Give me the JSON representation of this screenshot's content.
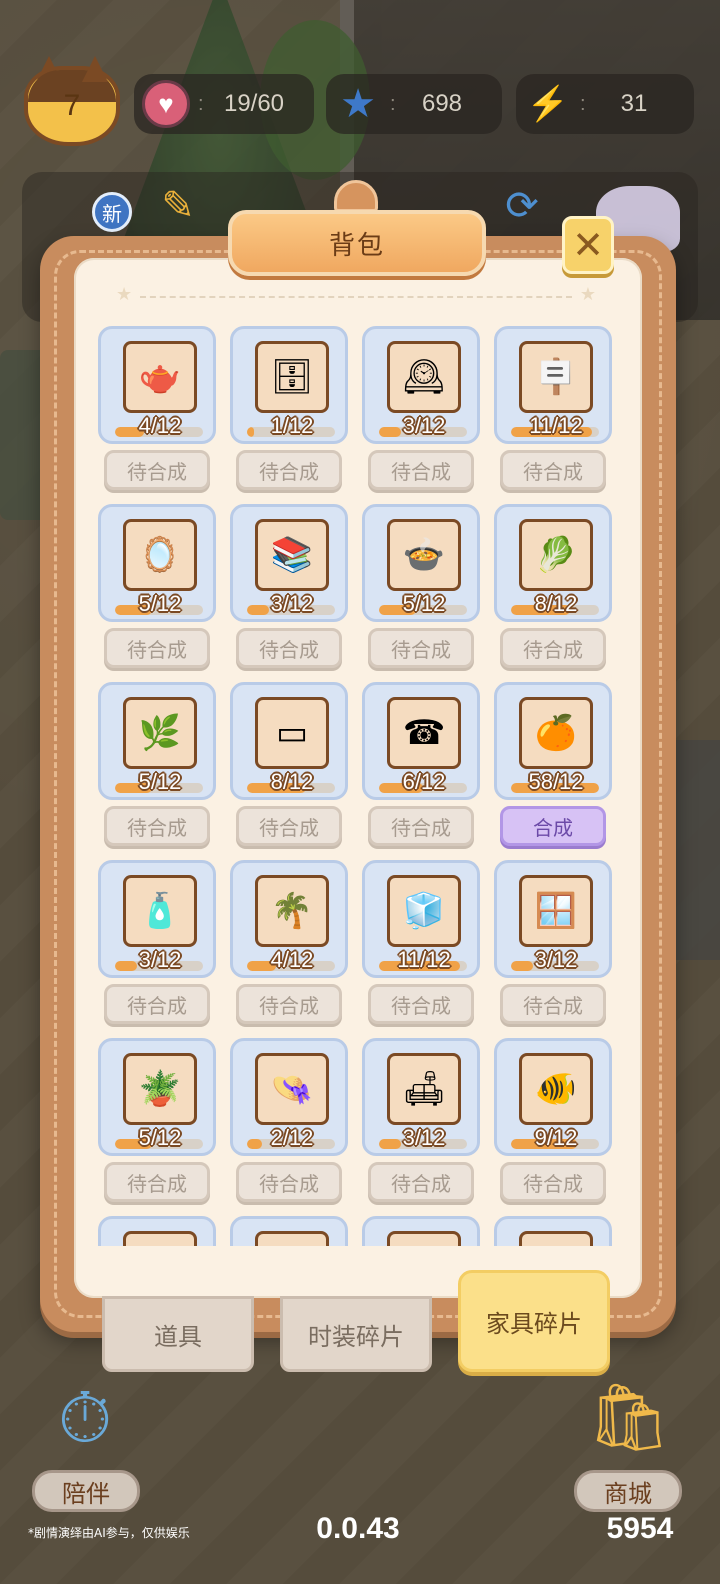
{
  "hud": {
    "level": "7",
    "hearts": {
      "icon": "heart-icon",
      "separator": ":",
      "value": "19/60"
    },
    "stars": {
      "icon": "star-plus-icon",
      "separator": ":",
      "value": "698"
    },
    "energy": {
      "icon": "lightning-plus-icon",
      "separator": ":",
      "value": "31"
    },
    "new_badge": "新"
  },
  "panel": {
    "title": "背包",
    "close_symbol": "✕"
  },
  "items": [
    {
      "icon": "tea-set-icon",
      "glyph": "🫖",
      "count": "4/12",
      "progress": 0.33,
      "action": "待合成",
      "ready": false
    },
    {
      "icon": "bookcase-icon",
      "glyph": "🗄",
      "count": "1/12",
      "progress": 0.08,
      "action": "待合成",
      "ready": false
    },
    {
      "icon": "cuckoo-clock-icon",
      "glyph": "🕰",
      "count": "3/12",
      "progress": 0.25,
      "action": "待合成",
      "ready": false
    },
    {
      "icon": "sign-table-icon",
      "glyph": "🪧",
      "count": "11/12",
      "progress": 0.92,
      "action": "待合成",
      "ready": false
    },
    {
      "icon": "mirror-shelf-icon",
      "glyph": "🪞",
      "count": "5/12",
      "progress": 0.42,
      "action": "待合成",
      "ready": false
    },
    {
      "icon": "wall-shelf-icon",
      "glyph": "📚",
      "count": "3/12",
      "progress": 0.25,
      "action": "待合成",
      "ready": false
    },
    {
      "icon": "kitchen-cabinet-icon",
      "glyph": "🍲",
      "count": "5/12",
      "progress": 0.42,
      "action": "待合成",
      "ready": false
    },
    {
      "icon": "cutting-board-icon",
      "glyph": "🥬",
      "count": "8/12",
      "progress": 0.67,
      "action": "待合成",
      "ready": false
    },
    {
      "icon": "hanging-plant-icon",
      "glyph": "🌿",
      "count": "5/12",
      "progress": 0.42,
      "action": "待合成",
      "ready": false
    },
    {
      "icon": "wooden-plank-icon",
      "glyph": "▭",
      "count": "8/12",
      "progress": 0.67,
      "action": "待合成",
      "ready": false
    },
    {
      "icon": "telephone-icon",
      "glyph": "☎",
      "count": "6/12",
      "progress": 0.5,
      "action": "待合成",
      "ready": false
    },
    {
      "icon": "orange-tree-pot-icon",
      "glyph": "🍊",
      "count": "58/12",
      "progress": 1.0,
      "action": "合成",
      "ready": true
    },
    {
      "icon": "side-cabinet-icon",
      "glyph": "🧴",
      "count": "3/12",
      "progress": 0.25,
      "action": "待合成",
      "ready": false
    },
    {
      "icon": "potted-palm-icon",
      "glyph": "🌴",
      "count": "4/12",
      "progress": 0.33,
      "action": "待合成",
      "ready": false
    },
    {
      "icon": "refrigerator-icon",
      "glyph": "🧊",
      "count": "11/12",
      "progress": 0.92,
      "action": "待合成",
      "ready": false
    },
    {
      "icon": "lattice-screen-icon",
      "glyph": "🪟",
      "count": "3/12",
      "progress": 0.25,
      "action": "待合成",
      "ready": false
    },
    {
      "icon": "monstera-pot-icon",
      "glyph": "🪴",
      "count": "5/12",
      "progress": 0.42,
      "action": "待合成",
      "ready": false
    },
    {
      "icon": "hat-stand-icon",
      "glyph": "👒",
      "count": "2/12",
      "progress": 0.17,
      "action": "待合成",
      "ready": false
    },
    {
      "icon": "wooden-bench-icon",
      "glyph": "🛋",
      "count": "3/12",
      "progress": 0.25,
      "action": "待合成",
      "ready": false
    },
    {
      "icon": "fishbowl-table-icon",
      "glyph": "🐠",
      "count": "9/12",
      "progress": 0.75,
      "action": "待合成",
      "ready": false
    },
    {
      "icon": "partial-item-plant-icon",
      "glyph": "🌱",
      "count": "",
      "progress": 0,
      "action": "",
      "ready": false
    },
    {
      "icon": "partial-item-shelf-icon",
      "glyph": "🪵",
      "count": "",
      "progress": 0,
      "action": "",
      "ready": false
    },
    {
      "icon": "partial-item-box-icon",
      "glyph": "📦",
      "count": "",
      "progress": 0,
      "action": "",
      "ready": false
    },
    {
      "icon": "partial-item-leaf-icon",
      "glyph": "🍃",
      "count": "",
      "progress": 0,
      "action": "",
      "ready": false
    }
  ],
  "tabs": [
    {
      "label": "道具",
      "active": false
    },
    {
      "label": "时装碎片",
      "active": false
    },
    {
      "label": "家具碎片",
      "active": true
    }
  ],
  "bottom": {
    "companion_label": "陪伴",
    "shop_label": "商城",
    "disclaimer": "*剧情演绎由AI参与，仅供娱乐",
    "version": "0.0.43",
    "coins": "5954"
  },
  "colors": {
    "panel_frame": "#c88c5e",
    "panel_inner": "#fbf1e3",
    "card_bg": "#d9e4f4",
    "progress_fill": "#f0a248",
    "ready_button": "#d7c2f5",
    "active_tab": "#fbe08a"
  }
}
